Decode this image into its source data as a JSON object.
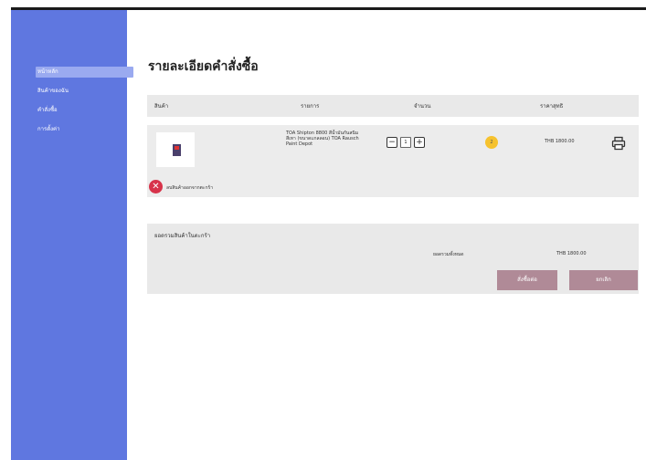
{
  "sidebar": {
    "items": [
      {
        "label": "หน้าหลัก"
      },
      {
        "label": "สินค้าของฉัน"
      },
      {
        "label": "คำสั่งซื้อ"
      },
      {
        "label": "การตั้งค่า"
      }
    ]
  },
  "page": {
    "title": "รายละเอียดคำสั่งซื้อ"
  },
  "table": {
    "headers": [
      "สินค้า",
      "รายการ",
      "จำนวน",
      "ราคาสุทธิ"
    ],
    "row": {
      "name": "TOA Shipton 8800 สีน้ำมันกันสนิม สีเทา (ขนาดแกลลอน) TOA Rausch Paint Depot",
      "quantity": "1",
      "badge": "2",
      "price": "THB 1800.00",
      "remove_label": "ลบสินค้าออกจากตะกร้า"
    }
  },
  "summary": {
    "heading": "ยอดรวมสินค้าในตะกร้า",
    "total_label": "ยอดรวมทั้งหมด",
    "total_value": "THB 1800.00",
    "order_button": "สั่งซื้อต่อ",
    "cancel_button": "ยกเลิก"
  },
  "colors": {
    "sidebar": "#5f77e0",
    "accent_button": "#b08a97",
    "badge": "#f6c22e",
    "remove": "#d7334a"
  }
}
